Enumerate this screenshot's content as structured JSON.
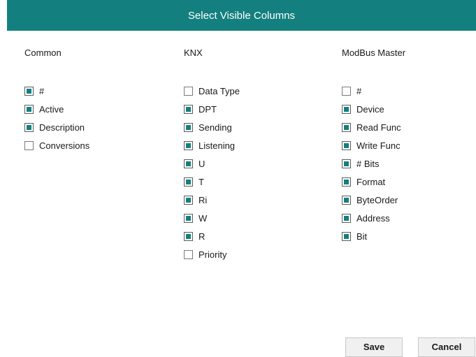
{
  "title": "Select Visible Columns",
  "accent_color": "#137f7f",
  "columns": [
    {
      "title": "Common",
      "options": [
        {
          "label": "#",
          "checked": true
        },
        {
          "label": "Active",
          "checked": true
        },
        {
          "label": "Description",
          "checked": true
        },
        {
          "label": "Conversions",
          "checked": false
        }
      ]
    },
    {
      "title": "KNX",
      "options": [
        {
          "label": "Data Type",
          "checked": false
        },
        {
          "label": "DPT",
          "checked": true
        },
        {
          "label": "Sending",
          "checked": true
        },
        {
          "label": "Listening",
          "checked": true
        },
        {
          "label": "U",
          "checked": true
        },
        {
          "label": "T",
          "checked": true
        },
        {
          "label": "Ri",
          "checked": true
        },
        {
          "label": "W",
          "checked": true
        },
        {
          "label": "R",
          "checked": true
        },
        {
          "label": "Priority",
          "checked": false
        }
      ]
    },
    {
      "title": "ModBus Master",
      "options": [
        {
          "label": "#",
          "checked": false
        },
        {
          "label": "Device",
          "checked": true
        },
        {
          "label": "Read Func",
          "checked": true
        },
        {
          "label": "Write Func",
          "checked": true
        },
        {
          "label": "# Bits",
          "checked": true
        },
        {
          "label": "Format",
          "checked": true
        },
        {
          "label": "ByteOrder",
          "checked": true
        },
        {
          "label": "Address",
          "checked": true
        },
        {
          "label": "Bit",
          "checked": true
        }
      ]
    }
  ],
  "buttons": {
    "save": "Save",
    "cancel": "Cancel"
  }
}
